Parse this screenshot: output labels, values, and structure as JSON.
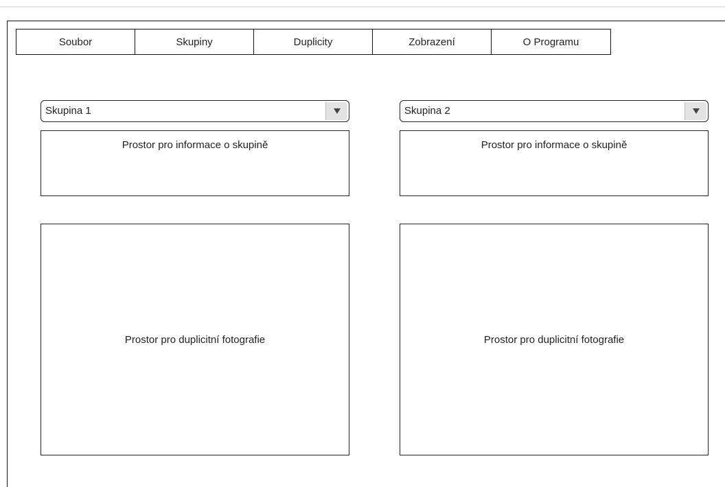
{
  "menu": {
    "items": [
      {
        "label": "Soubor"
      },
      {
        "label": "Skupiny"
      },
      {
        "label": "Duplicity"
      },
      {
        "label": "Zobrazení"
      },
      {
        "label": "O Programu"
      }
    ]
  },
  "left_panel": {
    "group_select": {
      "value": "Skupina 1",
      "icon": "triangle-down-icon"
    },
    "info_box": {
      "text": "Prostor pro informace o skupině"
    },
    "photos_box": {
      "text": "Prostor pro duplicitní fotografie"
    }
  },
  "right_panel": {
    "group_select": {
      "value": "Skupina 2",
      "icon": "triangle-down-icon"
    },
    "info_box": {
      "text": "Prostor pro informace o skupině"
    },
    "photos_box": {
      "text": "Prostor pro duplicitní fotografie"
    }
  },
  "colors": {
    "border": "#222222",
    "dropdown_button_bg": "#e3e3e3",
    "background": "#ffffff"
  }
}
